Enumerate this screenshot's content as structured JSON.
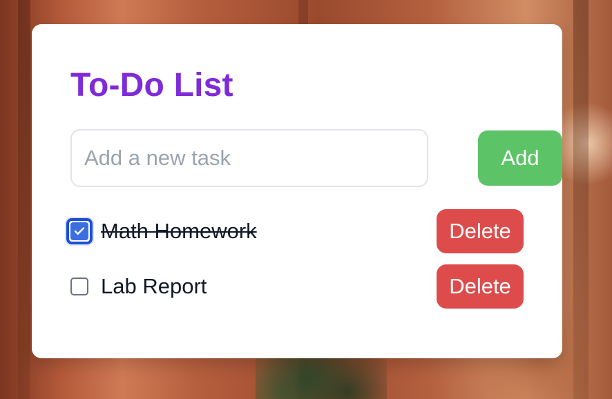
{
  "app": {
    "title": "To-Do List"
  },
  "theme": {
    "title_color": "#7e2bd8",
    "add_button_color": "#5cc466",
    "delete_button_color": "#dd4b4b",
    "checkbox_checked_color": "#3b6fe0"
  },
  "new_task": {
    "placeholder": "Add a new task",
    "value": ""
  },
  "buttons": {
    "add_label": "Add",
    "delete_label": "Delete"
  },
  "tasks": [
    {
      "label": "Math Homework",
      "completed": true
    },
    {
      "label": "Lab Report",
      "completed": false
    }
  ]
}
